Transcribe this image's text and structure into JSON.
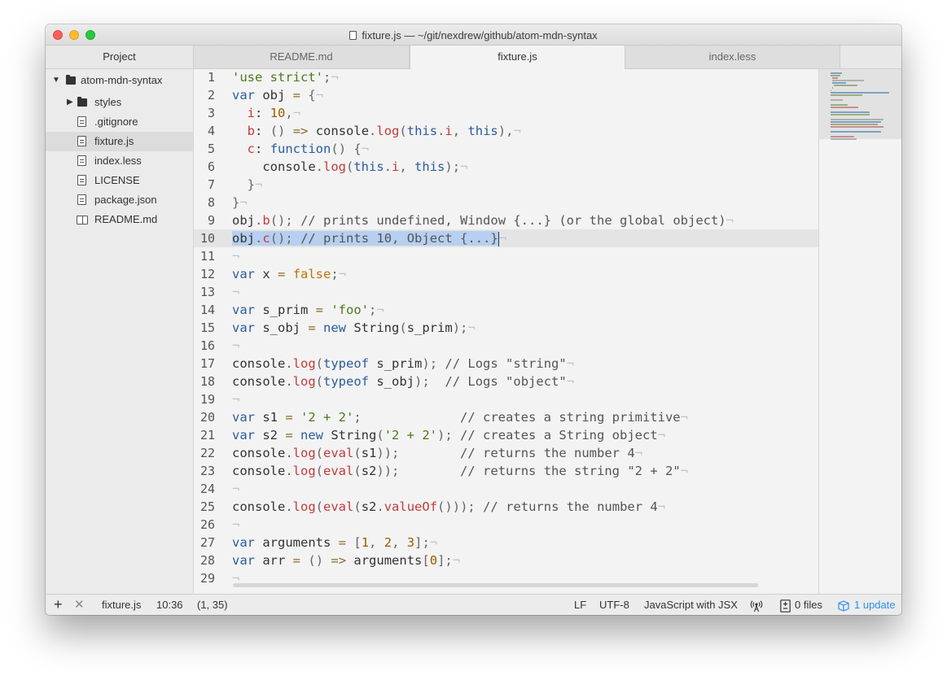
{
  "window": {
    "title": "fixture.js — ~/git/nexdrew/github/atom-mdn-syntax"
  },
  "tabs": {
    "project_label": "Project",
    "items": [
      {
        "label": "README.md"
      },
      {
        "label": "fixture.js"
      },
      {
        "label": "index.less"
      }
    ]
  },
  "tree": {
    "root": "atom-mdn-syntax",
    "items": [
      {
        "label": "styles",
        "kind": "folder"
      },
      {
        "label": ".gitignore",
        "kind": "file"
      },
      {
        "label": "fixture.js",
        "kind": "file",
        "selected": true
      },
      {
        "label": "index.less",
        "kind": "file"
      },
      {
        "label": "LICENSE",
        "kind": "file"
      },
      {
        "label": "package.json",
        "kind": "file"
      },
      {
        "label": "README.md",
        "kind": "book"
      }
    ]
  },
  "editor": {
    "cursor_line": 10,
    "invisible_eol": "¬",
    "lines": [
      "'use strict';",
      "var obj = {",
      "  i: 10,",
      "  b: () => console.log(this.i, this),",
      "  c: function() {",
      "    console.log(this.i, this);",
      "  }",
      "}",
      "obj.b(); // prints undefined, Window {...} (or the global object)",
      "obj.c(); // prints 10, Object {...}",
      "",
      "var x = false;",
      "",
      "var s_prim = 'foo';",
      "var s_obj = new String(s_prim);",
      "",
      "console.log(typeof s_prim); // Logs \"string\"",
      "console.log(typeof s_obj);  // Logs \"object\"",
      "",
      "var s1 = '2 + 2';             // creates a string primitive",
      "var s2 = new String('2 + 2'); // creates a String object",
      "console.log(eval(s1));        // returns the number 4",
      "console.log(eval(s2));        // returns the string \"2 + 2\"",
      "",
      "console.log(eval(s2.valueOf())); // returns the number 4",
      "",
      "var arguments = [1, 2, 3];",
      "var arr = () => arguments[0];",
      ""
    ]
  },
  "status": {
    "add_icon": "plus-icon",
    "close_icon": "x-icon",
    "file": "fixture.js",
    "position": "10:36",
    "selection": "(1, 35)",
    "line_ending": "LF",
    "encoding": "UTF-8",
    "grammar": "JavaScript with JSX",
    "broadcast_icon": "broadcast-icon",
    "git_icon": "diff-icon",
    "files": "0 files",
    "update_icon": "package-icon",
    "update": "1 update"
  },
  "colors": {
    "accent": "#2e8ff0",
    "selection": "#b7cff0",
    "keyword": "#2a5c9e",
    "string": "#4c7a18",
    "number": "#9a5c00",
    "function": "#c23b3b"
  }
}
